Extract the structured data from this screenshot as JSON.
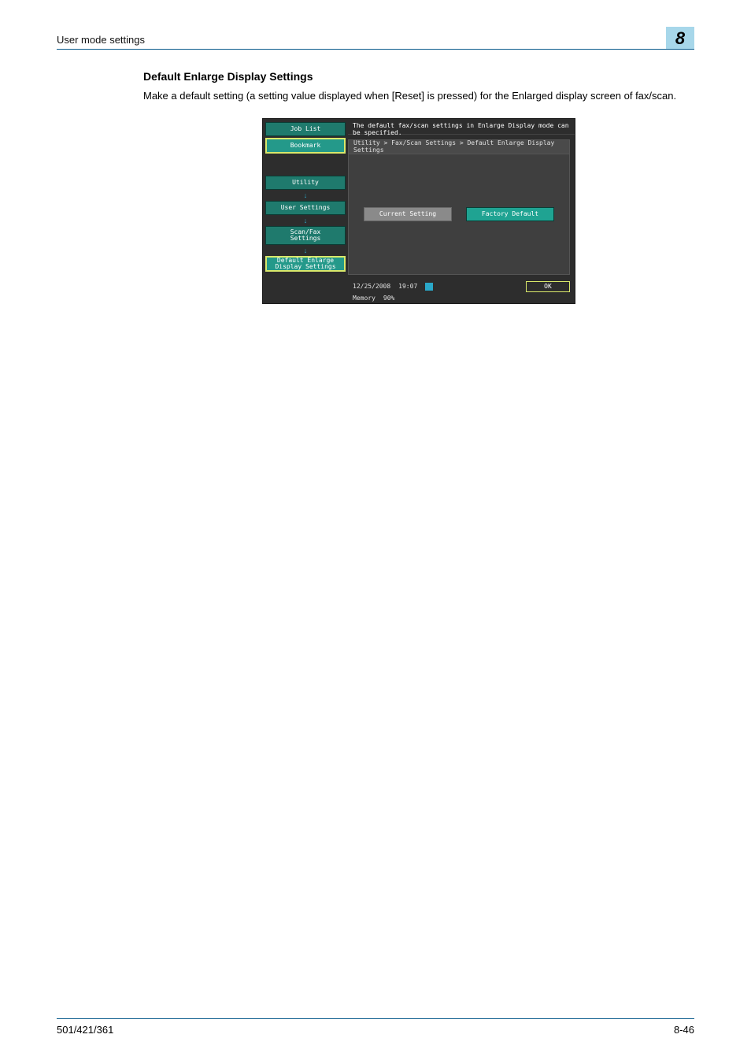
{
  "header": {
    "left": "User mode settings",
    "chapter": "8"
  },
  "section": {
    "title": "Default Enlarge Display Settings",
    "body": "Make a default setting (a setting value displayed when [Reset] is pressed) for the Enlarged display screen of fax/scan."
  },
  "screen": {
    "sidebar": {
      "job_list": "Job List",
      "bookmark": "Bookmark",
      "crumb1": "Utility",
      "crumb2": "User Settings",
      "crumb3": "Scan/Fax\nSettings",
      "crumb4": "Default Enlarge\nDisplay Settings"
    },
    "message": "The default fax/scan settings in Enlarge Display mode can be specified.",
    "breadcrumb": "Utility > Fax/Scan Settings > Default Enlarge Display Settings",
    "buttons": {
      "current": "Current Setting",
      "factory": "Factory Default"
    },
    "status": {
      "date": "12/25/2008",
      "time": "19:07",
      "mem_label": "Memory",
      "mem_value": "90%",
      "ok": "OK"
    }
  },
  "footer": {
    "left": "501/421/361",
    "right": "8-46"
  }
}
